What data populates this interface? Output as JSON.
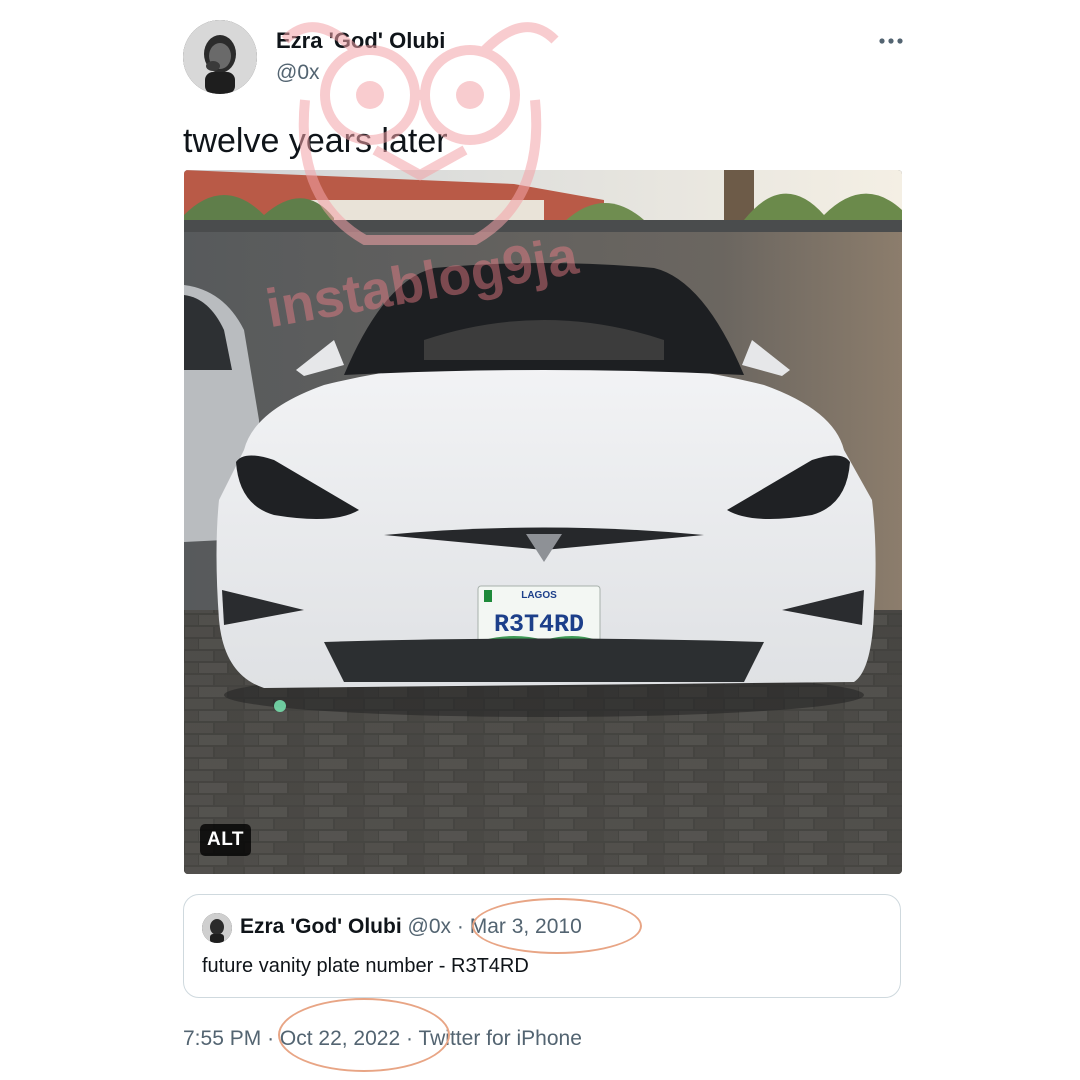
{
  "author": {
    "display_name": "Ezra 'God' Olubi",
    "handle": "@0x"
  },
  "tweet": {
    "text": "twelve years later"
  },
  "media": {
    "alt_badge": "ALT",
    "plate": {
      "state": "LAGOS",
      "number": "R3T4RD"
    }
  },
  "quoted_tweet": {
    "display_name": "Ezra 'God' Olubi",
    "handle": "@0x",
    "separator": "·",
    "date": "Mar 3, 2010",
    "text": "future vanity plate number - R3T4RD"
  },
  "footer": {
    "time": "7:55 PM",
    "separator": "·",
    "date": "Oct 22, 2022",
    "source": "Twitter for iPhone"
  },
  "watermark": {
    "text": "instablog9ja"
  },
  "colors": {
    "text_primary": "#0f1419",
    "text_secondary": "#536471",
    "border": "#cfd9de",
    "annotation_circle": "#e8a585",
    "watermark": "#f4a3a8"
  },
  "icons": {
    "more": "more-horizontal-icon"
  }
}
